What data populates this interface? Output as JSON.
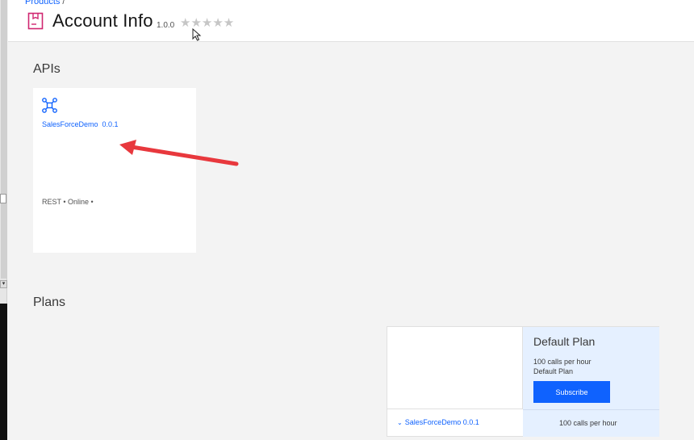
{
  "breadcrumb": {
    "label": "Products",
    "separator": "/"
  },
  "product": {
    "title": "Account Info",
    "version": "1.0.0",
    "rating_stars": "★★★★★",
    "rating_value": 0,
    "icon": "product-box-icon"
  },
  "apis": {
    "section_title": "APIs",
    "cards": [
      {
        "name": "SalesForceDemo  0.0.1",
        "meta": "REST • Online •",
        "icon": "api-network-icon"
      }
    ]
  },
  "plans": {
    "section_title": "Plans",
    "plan": {
      "name": "Default Plan",
      "rate_limit": "100 calls per hour",
      "description": "Default Plan",
      "subscribe_label": "Subscribe"
    },
    "rows": [
      {
        "api": "SalesForceDemo 0.0.1",
        "limit": "100 calls per hour",
        "icon": "chevron-down-icon"
      }
    ]
  },
  "colors": {
    "accent": "#0f62fe",
    "product_icon": "#d02670",
    "arrow": "#e8383d"
  }
}
